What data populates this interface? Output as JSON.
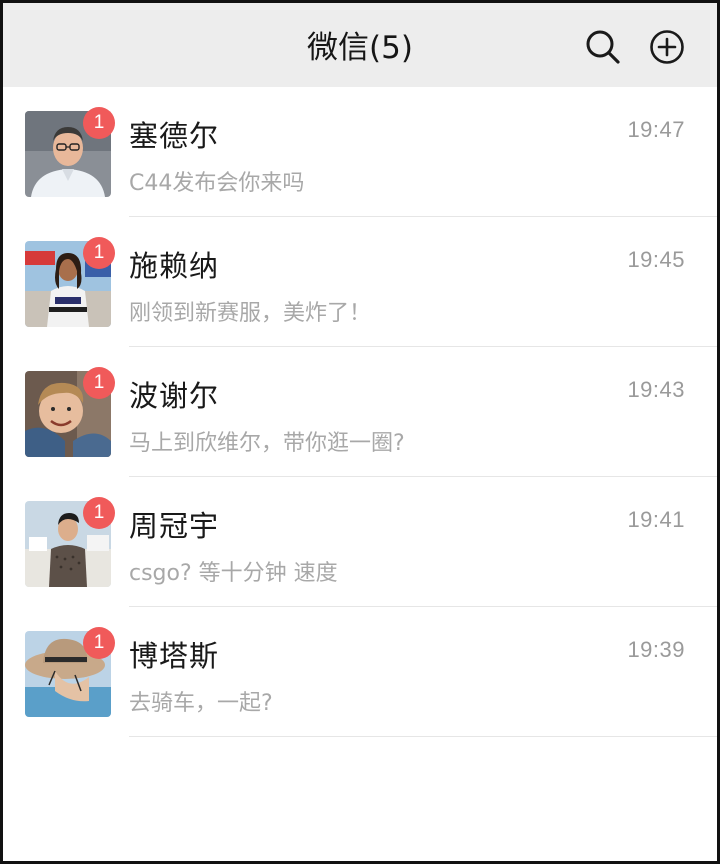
{
  "header": {
    "title": "微信(5)",
    "search_icon": "search-icon",
    "add_icon": "add-circle-icon"
  },
  "colors": {
    "header_bg": "#ededed",
    "badge": "#f05a5a",
    "name": "#191919",
    "secondary": "#a8a8a8"
  },
  "chats": [
    {
      "name": "塞德尔",
      "time": "19:47",
      "preview": "C44发布会你来吗",
      "unread": "1",
      "avatar": "avatar-man-glasses"
    },
    {
      "name": "施赖纳",
      "time": "19:45",
      "preview": "刚领到新赛服，美炸了！",
      "unread": "1",
      "avatar": "avatar-woman-racing-suit"
    },
    {
      "name": "波谢尔",
      "time": "19:43",
      "preview": "马上到欣维尔，带你逛一圈?",
      "unread": "1",
      "avatar": "avatar-boy-smiling"
    },
    {
      "name": "周冠宇",
      "time": "19:41",
      "preview": "csgo? 等十分钟 速度",
      "unread": "1",
      "avatar": "avatar-man-harbor"
    },
    {
      "name": "博塔斯",
      "time": "19:39",
      "preview": "去骑车，一起?",
      "unread": "1",
      "avatar": "avatar-person-hat"
    }
  ]
}
